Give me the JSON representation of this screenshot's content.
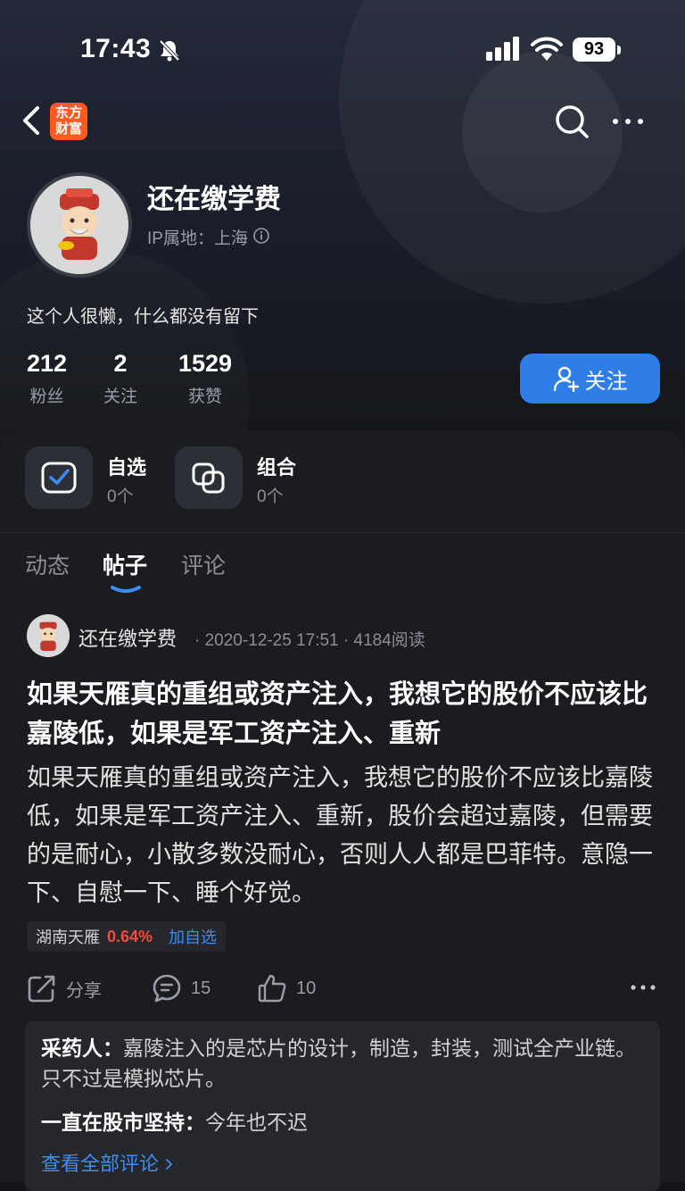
{
  "status_bar": {
    "time": "17:43",
    "battery": "93"
  },
  "nav": {
    "logo_text": "东方财富",
    "logo_line1": "东方",
    "logo_line2": "财富"
  },
  "profile": {
    "name": "还在缴学费",
    "ip_location": "IP属地：上海",
    "bio": "这个人很懒，什么都没有留下",
    "stats": [
      {
        "value": "212",
        "label": "粉丝"
      },
      {
        "value": "2",
        "label": "关注"
      },
      {
        "value": "1529",
        "label": "获赞"
      }
    ],
    "follow_label": "关注"
  },
  "quick_links": [
    {
      "title": "自选",
      "count": "0个",
      "icon": "checkbox-icon"
    },
    {
      "title": "组合",
      "count": "0个",
      "icon": "combo-icon"
    }
  ],
  "tabs": [
    {
      "label": "动态",
      "active": false
    },
    {
      "label": "帖子",
      "active": true
    },
    {
      "label": "评论",
      "active": false
    }
  ],
  "post": {
    "author": "还在缴学费",
    "meta": "· 2020-12-25 17:51 · 4184阅读",
    "title": "如果天雁真的重组或资产注入，我想它的股价不应该比嘉陵低，如果是军工资产注入、重新",
    "body": "如果天雁真的重组或资产注入，我想它的股价不应该比嘉陵低，如果是军工资产注入、重新，股价会超过嘉陵，但需要的是耐心，小散多数没耐心，否则人人都是巴菲特。意隐一下、自慰一下、睡个好觉。",
    "stock": {
      "name": "湖南天雁",
      "change": "0.64%",
      "add_label": "加自选"
    },
    "actions": {
      "share_label": "分享",
      "comments_count": "15",
      "likes_count": "10"
    }
  },
  "comments": [
    {
      "author": "采药人：",
      "text": "嘉陵注入的是芯片的设计，制造，封装，测试全产业链。只不过是模拟芯片。"
    },
    {
      "author": "一直在股市坚持：",
      "text": "今年也不迟"
    }
  ],
  "view_all_label": "查看全部评论",
  "colors": {
    "accent": "#2f7de6",
    "up_red": "#ef4b3b",
    "link_blue": "#3d8cf0"
  }
}
